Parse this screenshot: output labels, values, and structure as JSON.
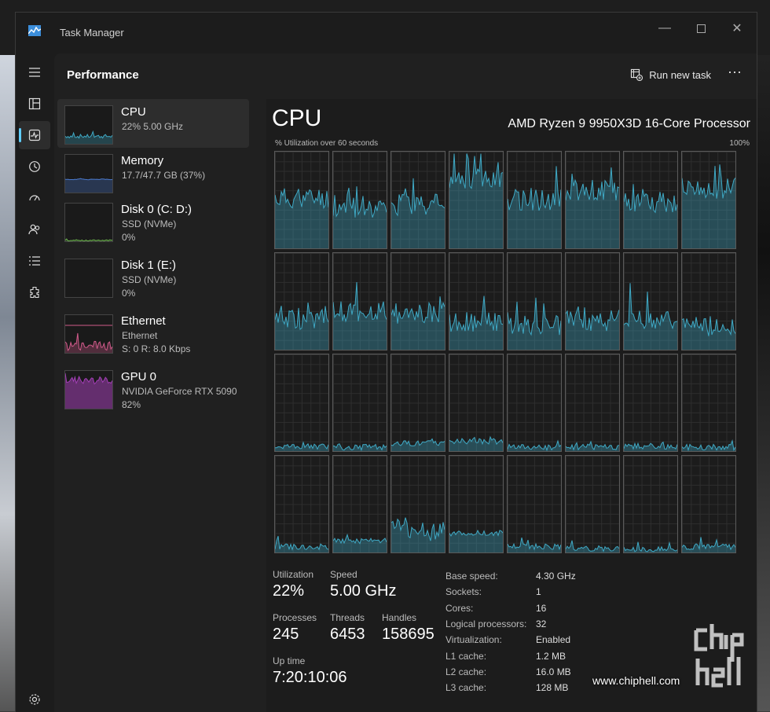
{
  "window": {
    "title": "Task Manager"
  },
  "header": {
    "page_title": "Performance",
    "run_new_task": "Run new task"
  },
  "nav": [
    "processes-icon",
    "performance-icon",
    "app-history-icon",
    "startup-apps-icon",
    "users-icon",
    "details-icon",
    "services-icon"
  ],
  "resources": [
    {
      "name": "CPU",
      "line1": "22%  5.00 GHz",
      "line2": "",
      "color": "#3fa9c5"
    },
    {
      "name": "Memory",
      "line1": "17.7/47.7 GB (37%)",
      "line2": "",
      "color": "#4b7bd0"
    },
    {
      "name": "Disk 0 (C: D:)",
      "line1": "SSD (NVMe)",
      "line2": "0%",
      "color": "#6ab04c"
    },
    {
      "name": "Disk 1 (E:)",
      "line1": "SSD (NVMe)",
      "line2": "0%",
      "color": "#6ab04c"
    },
    {
      "name": "Ethernet",
      "line1": "Ethernet",
      "line2": "S: 0  R: 8.0 Kbps",
      "color": "#d05a8a"
    },
    {
      "name": "GPU 0",
      "line1": "NVIDIA GeForce RTX 5090",
      "line2": "82%",
      "color": "#a23fb5"
    }
  ],
  "cpu": {
    "title": "CPU",
    "model": "AMD Ryzen 9 9950X3D 16-Core Processor",
    "graph_label": "% Utilization over 60 seconds",
    "graph_max": "100%",
    "graph_color": "#3fa9c5",
    "stats": {
      "utilization_label": "Utilization",
      "utilization": "22%",
      "speed_label": "Speed",
      "speed": "5.00 GHz",
      "processes_label": "Processes",
      "processes": "245",
      "threads_label": "Threads",
      "threads": "6453",
      "handles_label": "Handles",
      "handles": "158695",
      "uptime_label": "Up time",
      "uptime": "7:20:10:06"
    },
    "specs": [
      {
        "k": "Base speed:",
        "v": "4.30 GHz"
      },
      {
        "k": "Sockets:",
        "v": "1"
      },
      {
        "k": "Cores:",
        "v": "16"
      },
      {
        "k": "Logical processors:",
        "v": "32"
      },
      {
        "k": "Virtualization:",
        "v": "Enabled"
      },
      {
        "k": "L1 cache:",
        "v": "1.2 MB"
      },
      {
        "k": "L2 cache:",
        "v": "16.0 MB"
      },
      {
        "k": "L3 cache:",
        "v": "128 MB"
      }
    ]
  },
  "watermark": {
    "site": "www.chiphell.com",
    "logo": "chip hell"
  }
}
